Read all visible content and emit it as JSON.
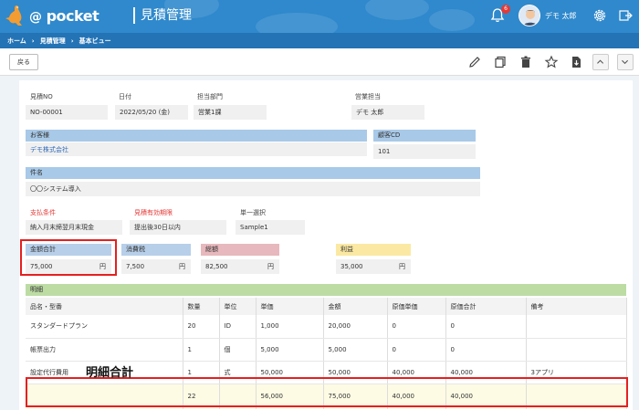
{
  "header": {
    "logo_text": "pocket",
    "logo_at": "@",
    "app_title": "見積管理",
    "notification_count": "6",
    "user_name": "デモ 太郎"
  },
  "breadcrumb": [
    "ホーム",
    "見積管理",
    "基本ビュー"
  ],
  "toolbar": {
    "back_label": "戻る"
  },
  "form": {
    "quote_no": {
      "label": "見積NO",
      "value": "NO-00001"
    },
    "date": {
      "label": "日付",
      "value": "2022/05/20 (金)"
    },
    "department": {
      "label": "担当部門",
      "value": "営業1課"
    },
    "sales_staff": {
      "label": "営業担当",
      "value": "デモ 太郎"
    },
    "customer": {
      "label": "お客様",
      "value": "デモ株式会社"
    },
    "customer_cd": {
      "label": "顧客CD",
      "value": "101"
    },
    "subject": {
      "label": "件名",
      "value": "〇〇システム導入"
    },
    "payment_terms": {
      "label": "支払条件",
      "value": "納入月末締翌月末現金"
    },
    "validity": {
      "label": "見積有効期限",
      "value": "提出後30日以内"
    },
    "single_select": {
      "label": "単一選択",
      "value": "Sample1"
    },
    "amount_total": {
      "label": "金額合計",
      "value": "75,000",
      "unit": "円"
    },
    "tax": {
      "label": "消費税",
      "value": "7,500",
      "unit": "円"
    },
    "grand_total": {
      "label": "総額",
      "value": "82,500",
      "unit": "円"
    },
    "profit": {
      "label": "利益",
      "value": "35,000",
      "unit": "円"
    }
  },
  "detail": {
    "title": "明細",
    "columns": [
      "品名・型番",
      "数量",
      "単位",
      "単価",
      "金額",
      "原価単価",
      "原価合計",
      "備考"
    ],
    "rows": [
      [
        "スタンダードプラン",
        "20",
        "ID",
        "1,000",
        "20,000",
        "0",
        "0",
        ""
      ],
      [
        "帳票出力",
        "1",
        "個",
        "5,000",
        "5,000",
        "0",
        "0",
        ""
      ],
      [
        "設定代行費用",
        "1",
        "式",
        "50,000",
        "50,000",
        "40,000",
        "40,000",
        "3アプリ"
      ]
    ],
    "total": [
      "",
      "22",
      "",
      "56,000",
      "75,000",
      "40,000",
      "40,000",
      ""
    ]
  },
  "annotation": "明細合計",
  "colors": {
    "accent_blue": "#2f89cc",
    "highlight_red": "#e52020"
  }
}
